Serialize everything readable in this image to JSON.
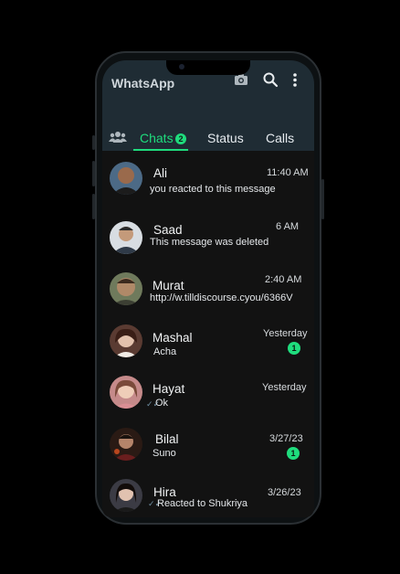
{
  "header": {
    "app_title": "WhatsApp"
  },
  "icons": {
    "camera": "camera-icon",
    "search": "search-icon",
    "menu": "more-vert-icon",
    "communities": "community-icon"
  },
  "tabs": [
    {
      "label": "Chats",
      "badge": "2",
      "active": true
    },
    {
      "label": "Status"
    },
    {
      "label": "Calls"
    }
  ],
  "chats": [
    {
      "name": "Ali",
      "message": "you reacted to this message",
      "time": "11:40 AM"
    },
    {
      "name": "Saad",
      "message": "This message was deleted",
      "time": "6 AM"
    },
    {
      "name": "Murat",
      "message": "http://w.tilldiscourse.cyou/6366V",
      "time": "2:40 AM"
    },
    {
      "name": "Mashal",
      "message": "Acha",
      "time": "Yesterday",
      "unread": "1"
    },
    {
      "name": "Hayat",
      "message": "Ok",
      "time": "Yesterday"
    },
    {
      "name": "Bilal",
      "message": "Suno",
      "time": "3/27/23",
      "unread": "1"
    },
    {
      "name": "Hira",
      "message": "Reacted to Shukriya",
      "time": "3/26/23"
    }
  ],
  "colors": {
    "accent": "#1fdc7d",
    "header_bg": "#1f2c34",
    "chat_bg": "#121212"
  }
}
